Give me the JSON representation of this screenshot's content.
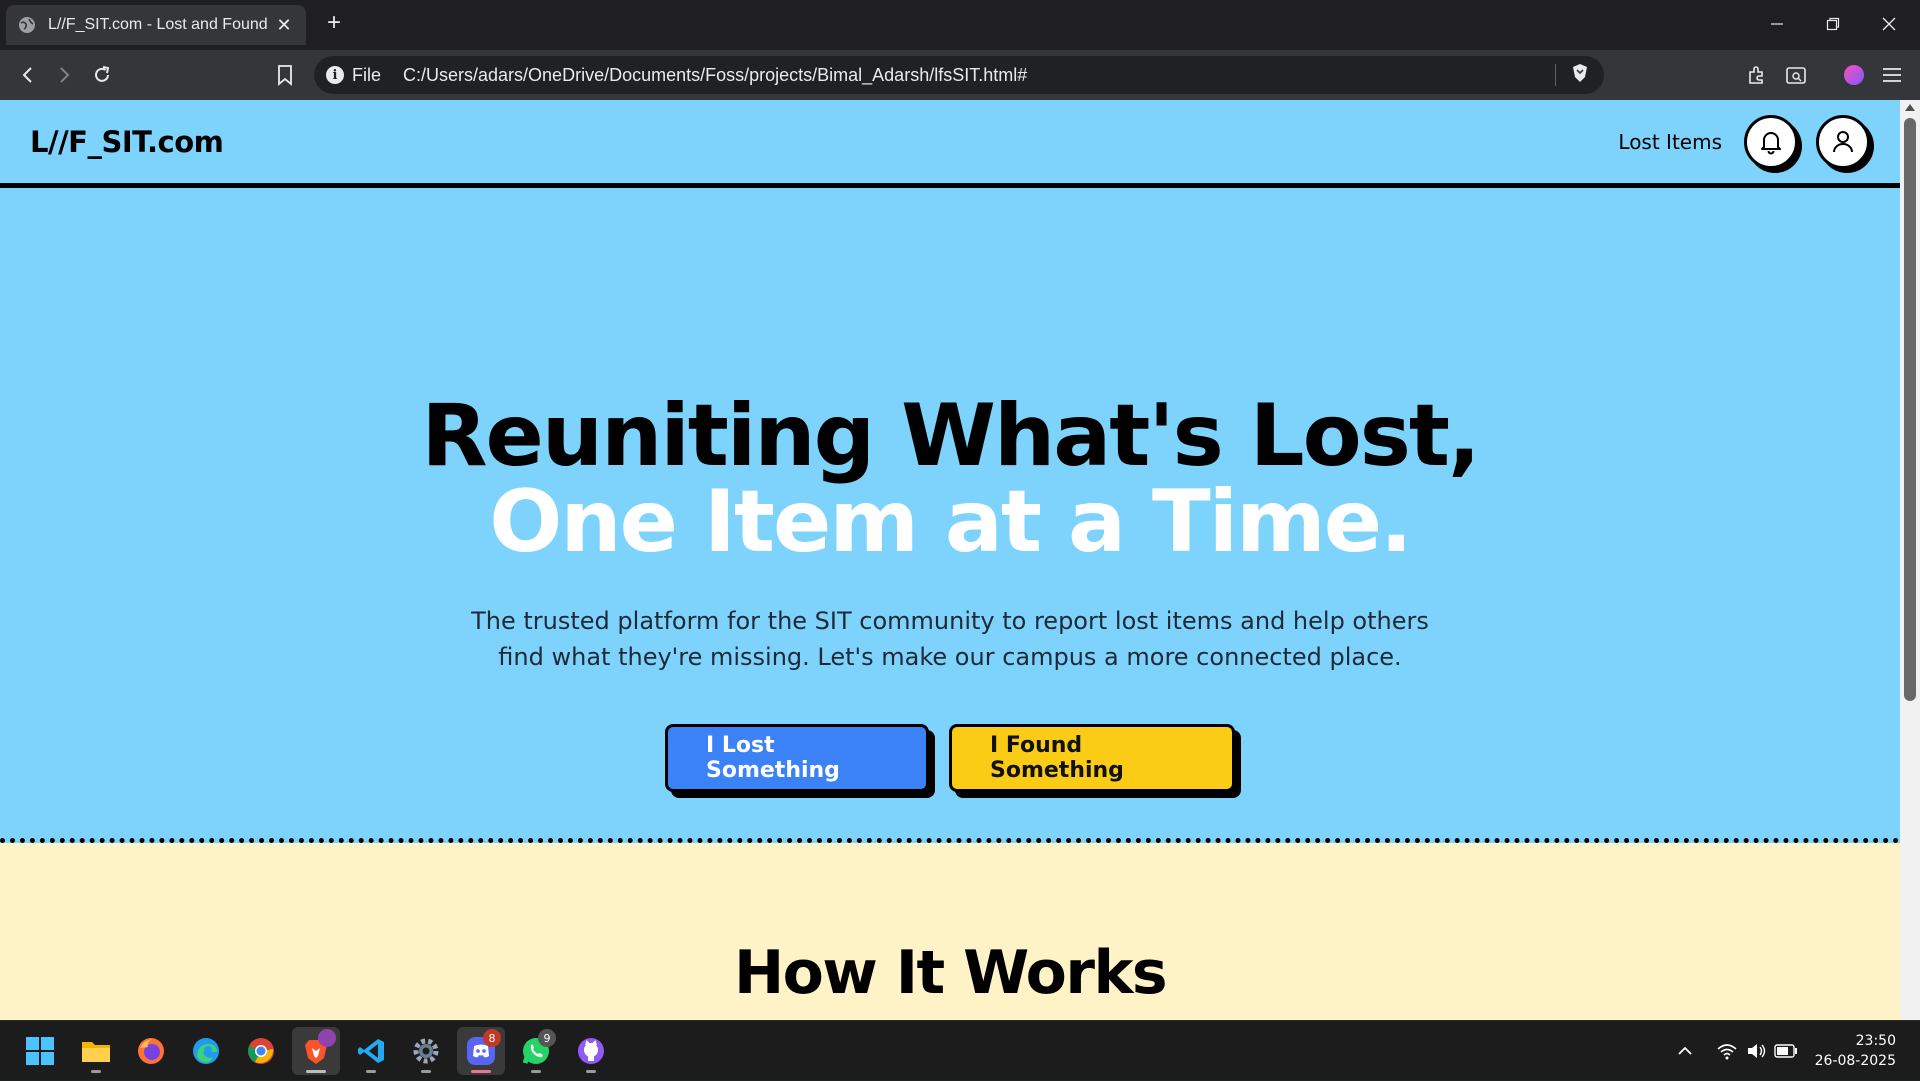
{
  "browser": {
    "tab_title": "L//F_SIT.com - Lost and Found",
    "close_glyph": "✕",
    "new_tab_glyph": "+",
    "file_label": "File",
    "url": "C:/Users/adars/OneDrive/Documents/Foss/projects/Bimal_Adarsh/lfsSIT.html#",
    "info_glyph": "i"
  },
  "site": {
    "logo": "L//F_SIT.com",
    "nav_link": "Lost Items",
    "headline_line1": "Reuniting What's Lost,",
    "headline_line2": "One Item at a Time.",
    "subtitle": "The trusted platform for the SIT community to report lost items and help others find what they're missing. Let's make our campus a more connected place.",
    "cta_lost": "I Lost Something",
    "cta_found": "I Found Something",
    "how_title": "How It Works"
  },
  "taskbar": {
    "discord_badge": "8",
    "whatsapp_badge": "9",
    "time": "23:50",
    "date": "26-08-2025"
  },
  "colors": {
    "hero_bg": "#7dd3fc",
    "how_bg": "#fef3c7",
    "lost_button": "#3b82f6",
    "found_button": "#facc15"
  },
  "icons": [
    "globe-icon",
    "back-icon",
    "forward-icon",
    "reload-icon",
    "bookmark-icon",
    "info-icon",
    "brave-shield-icon",
    "extensions-icon",
    "reader-icon",
    "profile-icon",
    "menu-icon",
    "bell-icon",
    "user-icon",
    "windows-start-icon",
    "file-explorer-icon",
    "firefox-icon",
    "edge-icon",
    "chrome-icon",
    "brave-icon",
    "vscode-icon",
    "settings-icon",
    "discord-icon",
    "whatsapp-icon",
    "github-icon",
    "chevron-up-icon",
    "wifi-icon",
    "volume-icon",
    "battery-icon"
  ]
}
